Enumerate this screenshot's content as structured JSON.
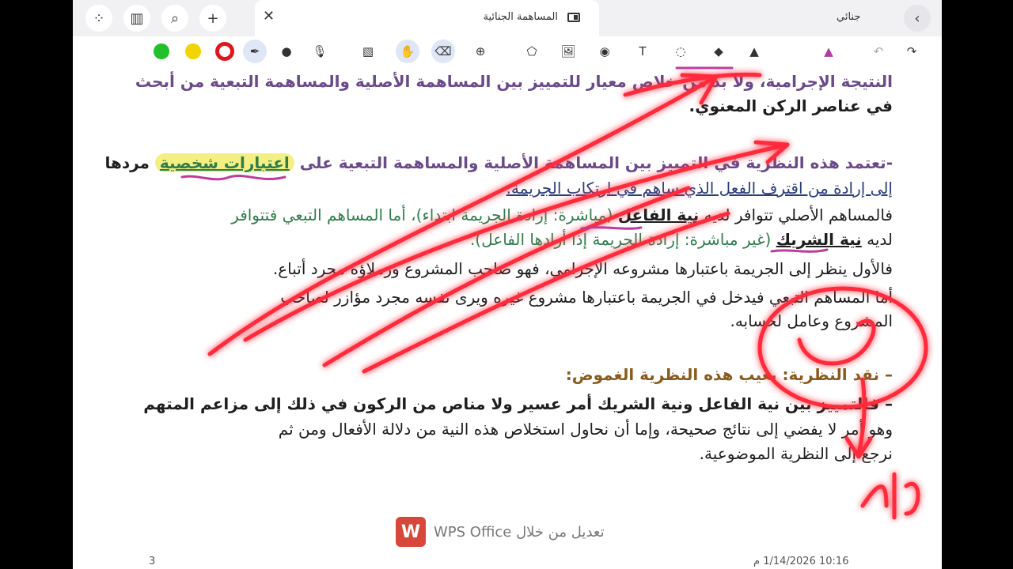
{
  "tabs": {
    "active_title": "المساهمة الجنائية",
    "right_title": "جنائي"
  },
  "toolbar": {
    "colors": [
      "#22c02a",
      "#f2d400",
      "#e0161c"
    ],
    "tools": [
      "pen-icon",
      "dot-icon",
      "mic-icon",
      "hatch-icon",
      "lasso-hand-icon",
      "eraser-icon",
      "zoom-icon",
      "shape-icon",
      "image-icon",
      "camera-icon",
      "text-icon",
      "selection-icon",
      "fill-icon",
      "highlighter-icon",
      "marker-icon",
      "undo-icon",
      "redo-icon"
    ]
  },
  "document": {
    "line1a": "النتيجة الإجرامية، ولا بد من خلاص معيار للتمييز بين المساهمة الأصلية والمساهمة التبعية من أبحث",
    "line2": "في عناصر الركن المعنوي.",
    "line3a": "-تعتمد هذه النظرية في التمييز بين المساهمة الأصلية والمساهمة التبعية على",
    "line3_highlight": "اعتبارات شخصية",
    "line3b": "مردها",
    "line4": "إلى إرادة من اقترف الفعل الذي ساهم في ارتكاب الجريمة.",
    "line5a": "فالمساهم الأصلي تتوافر لديه",
    "line5_bold": "نية الفاعل",
    "line5b": "(مباشرة: إرادة الجريمة ابتداء)، أما المساهم التبعي فتتوافر",
    "line6a": "لديه",
    "line6_bold": "نية الشريك",
    "line6b": "(غير مباشرة: إرادة الجريمة إذا أرادها الفاعل).",
    "line7": "فالأول ينظر إلى الجريمة باعتبارها مشروعه الإجرامي، فهو صاحب المشروع وزملاؤه مجرد أتباع.",
    "line8": "أما المساهم التبعي فيدخل في الجريمة باعتبارها مشروع غيره ويرى نفسه مجرد مؤازر لصاحب",
    "line9": "المشروع وعامل لحسابه.",
    "line10": "نقد النظرية: يعيب هذه النظرية الغموض:",
    "line11": "فالتمييز بين نية الفاعل ونية الشريك أمر عسير ولا مناص من الركون في ذلك إلى مزاعم المتهم",
    "line12": "وهو أمر لا يفضي إلى نتائج صحيحة، وإما أن نحاول استخلاص هذه النية من دلالة الأفعال ومن ثم",
    "line13": "نرجع إلى النظرية الموضوعية.",
    "bullet": "–"
  },
  "handwriting": {
    "circle_note": "س",
    "bottom_note": "الفا"
  },
  "footer": {
    "watermark_text": "تعديل من خلال WPS Office",
    "logo_letter": "W",
    "page_number": "3",
    "timestamp": "10:16 1/14/2026 م"
  }
}
